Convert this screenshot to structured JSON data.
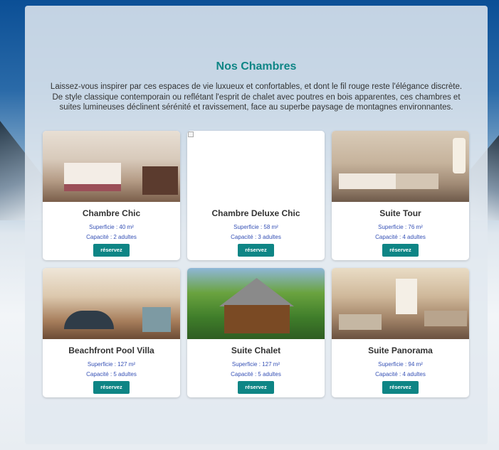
{
  "section": {
    "title": "Nos Chambres",
    "intro": "Laissez-vous inspirer par ces espaces de vie luxueux et confortables, et dont le fil rouge reste l'élégance discrète. De style classique contemporain ou reflétant l'esprit de chalet avec poutres en bois apparentes, ces chambres et suites lumineuses déclinent sérénité et ravissement, face au superbe paysage de montagnes environnantes."
  },
  "rooms": [
    {
      "name": "Chambre Chic",
      "superficie": "Superficie : 40 m²",
      "capacite": "Capacité : 2 adultes",
      "button": "réservez"
    },
    {
      "name": "Chambre Deluxe Chic",
      "superficie": "Superficie : 58 m²",
      "capacite": "Capacité : 3 adultes",
      "button": "réservez"
    },
    {
      "name": "Suite Tour",
      "superficie": "Superficie : 76 m²",
      "capacite": "Capacité : 4 adultes",
      "button": "réservez"
    },
    {
      "name": "Beachfront Pool Villa",
      "superficie": "Superficie : 127 m²",
      "capacite": "Capacité : 5 adultes",
      "button": "réservez"
    },
    {
      "name": "Suite Chalet",
      "superficie": "Superficie : 127 m²",
      "capacite": "Capacité : 5 adultes",
      "button": "réservez"
    },
    {
      "name": "Suite Panorama",
      "superficie": "Superficie : 94 m²",
      "capacite": "Capacité : 4 adultes",
      "button": "réservez"
    }
  ],
  "colors": {
    "accent": "#0e8585",
    "info_text": "#3550b5"
  }
}
